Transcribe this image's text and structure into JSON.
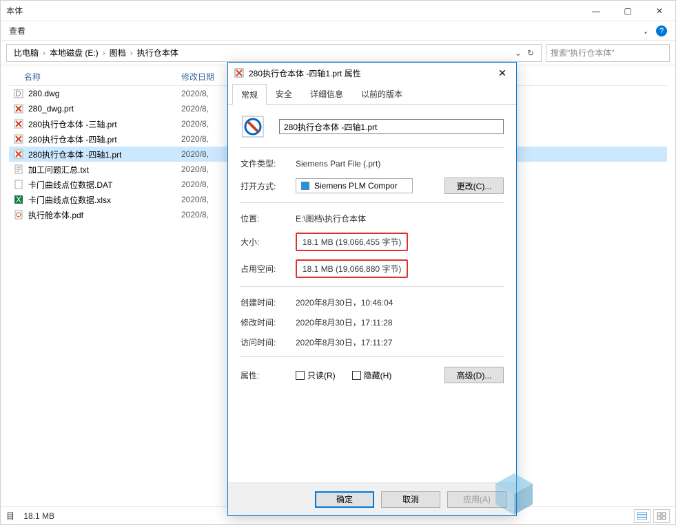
{
  "window": {
    "title_suffix": "本体",
    "menu": {
      "view": "查看"
    },
    "controls": {
      "min": "—",
      "max": "▢",
      "close": "✕",
      "expand": "⌄"
    }
  },
  "help_icon": "?",
  "breadcrumb": {
    "segs": [
      "比电脑",
      "本地磁盘 (E:)",
      "图档",
      "执行仓本体"
    ],
    "refresh": "↻",
    "dropdown": "⌄"
  },
  "search": {
    "placeholder": "搜索\"执行仓本体\""
  },
  "columns": {
    "name": "名称",
    "date": "修改日期"
  },
  "files": [
    {
      "icon": "dwg",
      "name": "280.dwg",
      "date": "2020/8,"
    },
    {
      "icon": "prt",
      "name": "280_dwg.prt",
      "date": "2020/8,"
    },
    {
      "icon": "prt",
      "name": "280执行仓本体 -三轴.prt",
      "date": "2020/8,"
    },
    {
      "icon": "prt",
      "name": "280执行仓本体 -四轴.prt",
      "date": "2020/8,"
    },
    {
      "icon": "prt",
      "name": "280执行仓本体 -四轴1.prt",
      "date": "2020/8,",
      "selected": true
    },
    {
      "icon": "txt",
      "name": "加工问题汇总.txt",
      "date": "2020/8,"
    },
    {
      "icon": "dat",
      "name": "卡门曲线点位数据.DAT",
      "date": "2020/8,"
    },
    {
      "icon": "xlsx",
      "name": "卡门曲线点位数据.xlsx",
      "date": "2020/8,"
    },
    {
      "icon": "pdf",
      "name": "执行舱本体.pdf",
      "date": "2020/8,"
    }
  ],
  "status": {
    "size": "18.1 MB",
    "count_suffix": "目"
  },
  "dialog": {
    "title": "280执行仓本体 -四轴1.prt 属性",
    "tabs": [
      "常规",
      "安全",
      "详细信息",
      "以前的版本"
    ],
    "filename": "280执行仓本体 -四轴1.prt",
    "labels": {
      "filetype": "文件类型:",
      "openwith": "打开方式:",
      "location": "位置:",
      "size": "大小:",
      "disk": "占用空间:",
      "created": "创建时间:",
      "modified": "修改时间:",
      "accessed": "访问时间:",
      "attrs": "属性:"
    },
    "values": {
      "filetype": "Siemens Part File (.prt)",
      "openwith": "Siemens PLM Compor",
      "location": "E:\\图档\\执行仓本体",
      "size": "18.1 MB (19,066,455 字节)",
      "disk": "18.1 MB (19,066,880 字节)",
      "created": "2020年8月30日，10:46:04",
      "modified": "2020年8月30日，17:11:28",
      "accessed": "2020年8月30日，17:11:27"
    },
    "buttons": {
      "change": "更改(C)...",
      "advanced": "高级(D)...",
      "ok": "确定",
      "cancel": "取消",
      "apply": "应用(A)"
    },
    "checkboxes": {
      "readonly": "只读(R)",
      "hidden": "隐藏(H)"
    }
  }
}
